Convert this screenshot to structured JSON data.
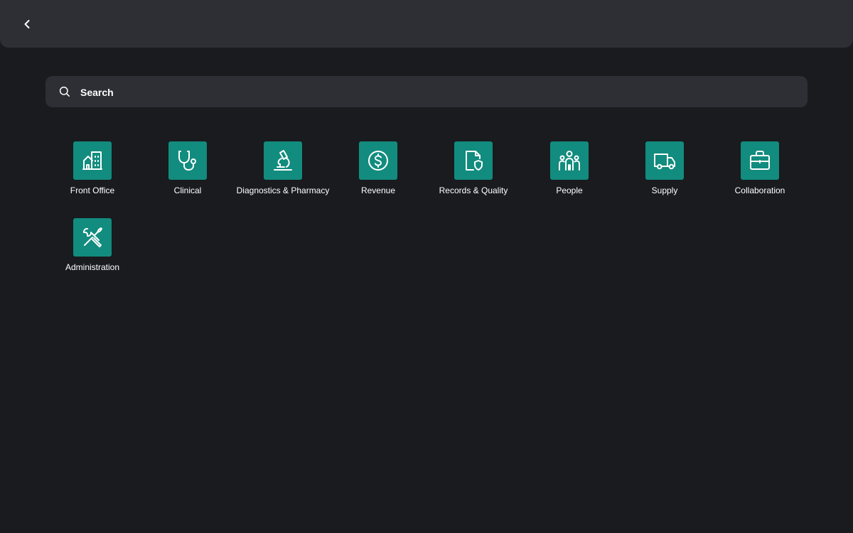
{
  "header": {
    "back_icon": "chevron-left-icon"
  },
  "search": {
    "placeholder": "Search",
    "value": "",
    "icon": "search-icon"
  },
  "theme": {
    "tile_color": "#128c7e",
    "background": "#191b1f",
    "surface": "#2d2f34"
  },
  "apps": [
    {
      "label": "Front Office",
      "icon": "building-icon"
    },
    {
      "label": "Clinical",
      "icon": "stethoscope-icon"
    },
    {
      "label": "Diagnostics & Pharmacy",
      "icon": "microscope-icon"
    },
    {
      "label": "Revenue",
      "icon": "dollar-circle-icon"
    },
    {
      "label": "Records & Quality",
      "icon": "document-shield-icon"
    },
    {
      "label": "People",
      "icon": "people-icon"
    },
    {
      "label": "Supply",
      "icon": "truck-icon"
    },
    {
      "label": "Collaboration",
      "icon": "briefcase-icon"
    },
    {
      "label": "Administration",
      "icon": "tools-icon"
    }
  ]
}
